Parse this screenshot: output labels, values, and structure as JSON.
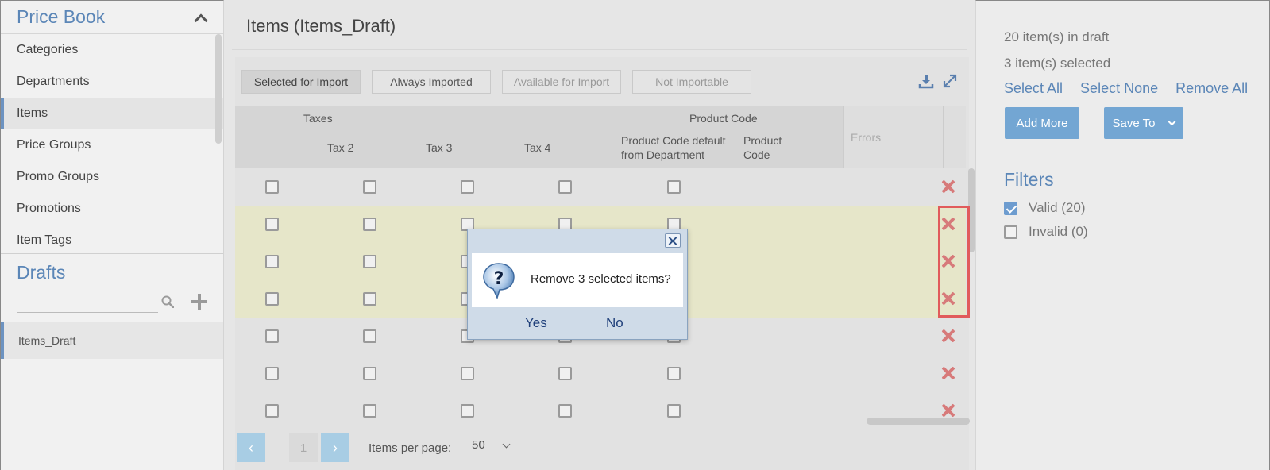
{
  "sidebar": {
    "title": "Price Book",
    "items": [
      {
        "label": "Categories"
      },
      {
        "label": "Departments"
      },
      {
        "label": "Items"
      },
      {
        "label": "Price Groups"
      },
      {
        "label": "Promo Groups"
      },
      {
        "label": "Promotions"
      },
      {
        "label": "Item Tags"
      }
    ],
    "active_item": "Items",
    "drafts_title": "Drafts",
    "drafts_search_value": "",
    "drafts": [
      {
        "label": "Items_Draft"
      }
    ]
  },
  "main": {
    "title": "Items (Items_Draft)",
    "tabs": [
      {
        "label": "Selected for Import",
        "selected": true
      },
      {
        "label": "Always Imported",
        "selected": false
      },
      {
        "label": "Available for Import",
        "selected": false
      },
      {
        "label": "Not Importable",
        "selected": false
      }
    ],
    "grid": {
      "group_headers": {
        "taxes": "Taxes",
        "product_code": "Product Code"
      },
      "columns": {
        "tax2": "Tax 2",
        "tax3": "Tax 3",
        "tax4": "Tax 4",
        "pc_default_line1": "Product Code default",
        "pc_default_line2": "from Department",
        "pc_line1": "Product",
        "pc_line2": "Code",
        "errors": "Errors"
      },
      "rows": [
        {
          "highlighted": false
        },
        {
          "highlighted": true
        },
        {
          "highlighted": true
        },
        {
          "highlighted": true
        },
        {
          "highlighted": false
        },
        {
          "highlighted": false
        },
        {
          "highlighted": false
        }
      ]
    },
    "pager": {
      "prev": "‹",
      "page": "1",
      "next": "›",
      "per_page_label": "Items per page:",
      "per_page_value": "50"
    }
  },
  "right": {
    "draft_count": "20 item(s) in draft",
    "selected_count": "3 item(s) selected",
    "select_all": "Select All",
    "select_none": "Select None",
    "remove_all": "Remove All",
    "add_more": "Add More",
    "save_to": "Save To",
    "filters_title": "Filters",
    "filters": [
      {
        "label": "Valid (20)",
        "checked": true
      },
      {
        "label": "Invalid (0)",
        "checked": false
      }
    ]
  },
  "dialog": {
    "message": "Remove 3 selected items?",
    "yes": "Yes",
    "no": "No"
  },
  "colors": {
    "accent": "#5b86b7",
    "button": "#73a6d3",
    "highlight_row": "#e6e6c9",
    "remove_icon": "#d77a7a",
    "annotation_box": "#e15b5b"
  }
}
